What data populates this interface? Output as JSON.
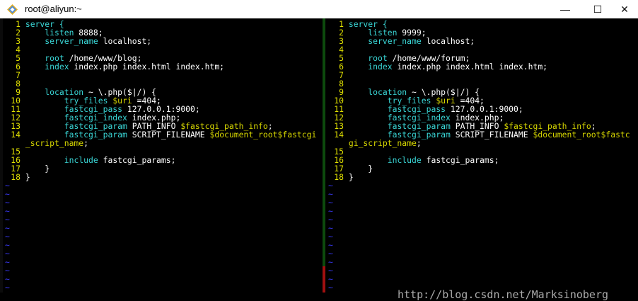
{
  "window": {
    "title": "root@aliyun:~",
    "minimize_glyph": "—",
    "maximize_glyph": "☐",
    "close_glyph": "✕",
    "icon": "putty-icon"
  },
  "left_pane": {
    "lines": [
      {
        "n": "1",
        "segs": [
          {
            "t": "server {",
            "c": "kw"
          }
        ]
      },
      {
        "n": "2",
        "segs": [
          {
            "t": "    ",
            "c": "code"
          },
          {
            "t": "listen",
            "c": "kw"
          },
          {
            "t": " 8888;",
            "c": "code"
          }
        ]
      },
      {
        "n": "3",
        "segs": [
          {
            "t": "    ",
            "c": "code"
          },
          {
            "t": "server_name",
            "c": "kw"
          },
          {
            "t": " localhost;",
            "c": "code"
          }
        ]
      },
      {
        "n": "4",
        "segs": []
      },
      {
        "n": "5",
        "segs": [
          {
            "t": "    ",
            "c": "code"
          },
          {
            "t": "root",
            "c": "kw"
          },
          {
            "t": " /home/www/blog;",
            "c": "code"
          }
        ]
      },
      {
        "n": "6",
        "segs": [
          {
            "t": "    ",
            "c": "code"
          },
          {
            "t": "index",
            "c": "kw"
          },
          {
            "t": " index.php index.html index.htm;",
            "c": "code"
          }
        ]
      },
      {
        "n": "7",
        "segs": []
      },
      {
        "n": "8",
        "segs": []
      },
      {
        "n": "9",
        "segs": [
          {
            "t": "    ",
            "c": "code"
          },
          {
            "t": "location",
            "c": "kw"
          },
          {
            "t": " ~ \\.php($|/) {",
            "c": "code"
          }
        ]
      },
      {
        "n": "10",
        "segs": [
          {
            "t": "        ",
            "c": "code"
          },
          {
            "t": "try_files",
            "c": "kw"
          },
          {
            "t": " ",
            "c": "code"
          },
          {
            "t": "$uri",
            "c": "var"
          },
          {
            "t": " =404;",
            "c": "code"
          }
        ]
      },
      {
        "n": "11",
        "segs": [
          {
            "t": "        ",
            "c": "code"
          },
          {
            "t": "fastcgi_pass",
            "c": "kw"
          },
          {
            "t": " 127.0.0.1:9000;",
            "c": "code"
          }
        ]
      },
      {
        "n": "12",
        "segs": [
          {
            "t": "        ",
            "c": "code"
          },
          {
            "t": "fastcgi_index",
            "c": "kw"
          },
          {
            "t": " index.php;",
            "c": "code"
          }
        ]
      },
      {
        "n": "13",
        "segs": [
          {
            "t": "        ",
            "c": "code"
          },
          {
            "t": "fastcgi_param",
            "c": "kw"
          },
          {
            "t": " PATH_INFO ",
            "c": "code"
          },
          {
            "t": "$fastcgi_path_info",
            "c": "var"
          },
          {
            "t": ";",
            "c": "code"
          }
        ]
      },
      {
        "n": "14",
        "segs": [
          {
            "t": "        ",
            "c": "code"
          },
          {
            "t": "fastcgi_param",
            "c": "kw"
          },
          {
            "t": " SCRIPT_FILENAME ",
            "c": "code"
          },
          {
            "t": "$document_roo",
            "c": "var"
          },
          {
            "t": "t$fastcgi",
            "c": "var"
          }
        ]
      },
      {
        "n": "",
        "segs": [
          {
            "t": "_script_name",
            "c": "var"
          },
          {
            "t": ";",
            "c": "code"
          }
        ]
      },
      {
        "n": "15",
        "segs": []
      },
      {
        "n": "16",
        "segs": [
          {
            "t": "        ",
            "c": "code"
          },
          {
            "t": "include",
            "c": "kw"
          },
          {
            "t": " fastcgi_params;",
            "c": "code"
          }
        ]
      },
      {
        "n": "17",
        "segs": [
          {
            "t": "    }",
            "c": "code"
          }
        ]
      },
      {
        "n": "18",
        "segs": [
          {
            "t": "}",
            "c": "code"
          }
        ]
      }
    ]
  },
  "right_pane": {
    "lines": [
      {
        "n": "1",
        "segs": [
          {
            "t": "server {",
            "c": "kw"
          }
        ]
      },
      {
        "n": "2",
        "segs": [
          {
            "t": "    ",
            "c": "code"
          },
          {
            "t": "listen",
            "c": "kw"
          },
          {
            "t": " 9999;",
            "c": "code"
          }
        ]
      },
      {
        "n": "3",
        "segs": [
          {
            "t": "    ",
            "c": "code"
          },
          {
            "t": "server_name",
            "c": "kw"
          },
          {
            "t": " localhost;",
            "c": "code"
          }
        ]
      },
      {
        "n": "4",
        "segs": []
      },
      {
        "n": "5",
        "segs": [
          {
            "t": "    ",
            "c": "code"
          },
          {
            "t": "root",
            "c": "kw"
          },
          {
            "t": " /home/www/forum;",
            "c": "code"
          }
        ]
      },
      {
        "n": "6",
        "segs": [
          {
            "t": "    ",
            "c": "code"
          },
          {
            "t": "index",
            "c": "kw"
          },
          {
            "t": " index.php index.html index.htm;",
            "c": "code"
          }
        ]
      },
      {
        "n": "7",
        "segs": []
      },
      {
        "n": "8",
        "segs": []
      },
      {
        "n": "9",
        "segs": [
          {
            "t": "    ",
            "c": "code"
          },
          {
            "t": "location",
            "c": "kw"
          },
          {
            "t": " ~ \\.php($|/) {",
            "c": "code"
          }
        ]
      },
      {
        "n": "10",
        "segs": [
          {
            "t": "        ",
            "c": "code"
          },
          {
            "t": "try_files",
            "c": "kw"
          },
          {
            "t": " ",
            "c": "code"
          },
          {
            "t": "$uri",
            "c": "var"
          },
          {
            "t": " =404;",
            "c": "code"
          }
        ]
      },
      {
        "n": "11",
        "segs": [
          {
            "t": "        ",
            "c": "code"
          },
          {
            "t": "fastcgi_pass",
            "c": "kw"
          },
          {
            "t": " 127.0.0.1:9000;",
            "c": "code"
          }
        ]
      },
      {
        "n": "12",
        "segs": [
          {
            "t": "        ",
            "c": "code"
          },
          {
            "t": "fastcgi_index",
            "c": "kw"
          },
          {
            "t": " index.php;",
            "c": "code"
          }
        ]
      },
      {
        "n": "13",
        "segs": [
          {
            "t": "        ",
            "c": "code"
          },
          {
            "t": "fastcgi_param",
            "c": "kw"
          },
          {
            "t": " PATH_INFO ",
            "c": "code"
          },
          {
            "t": "$fastcgi_path_info",
            "c": "var"
          },
          {
            "t": ";",
            "c": "code"
          }
        ]
      },
      {
        "n": "14",
        "segs": [
          {
            "t": "        ",
            "c": "code"
          },
          {
            "t": "fastcgi_param",
            "c": "kw"
          },
          {
            "t": " SCRIPT_FILENAME ",
            "c": "code"
          },
          {
            "t": "$document_root$fastc",
            "c": "var"
          }
        ]
      },
      {
        "n": "",
        "segs": [
          {
            "t": "gi_script_name",
            "c": "var"
          },
          {
            "t": ";",
            "c": "code"
          }
        ]
      },
      {
        "n": "15",
        "segs": []
      },
      {
        "n": "16",
        "segs": [
          {
            "t": "        ",
            "c": "code"
          },
          {
            "t": "include",
            "c": "kw"
          },
          {
            "t": " fastcgi_params;",
            "c": "code"
          }
        ]
      },
      {
        "n": "17",
        "segs": [
          {
            "t": "    }",
            "c": "code"
          }
        ]
      },
      {
        "n": "18",
        "segs": [
          {
            "t": "}",
            "c": "code"
          }
        ]
      }
    ]
  },
  "empty_line_marker": "~",
  "watermark": "http://blog.csdn.net/Marksinoberg",
  "colors": {
    "line_number": "#e0e000",
    "keyword": "#3ad7d7",
    "variable": "#d8d800",
    "text": "#ffffff",
    "tilde": "#3a3af8",
    "separator": "#0d4a0d"
  }
}
